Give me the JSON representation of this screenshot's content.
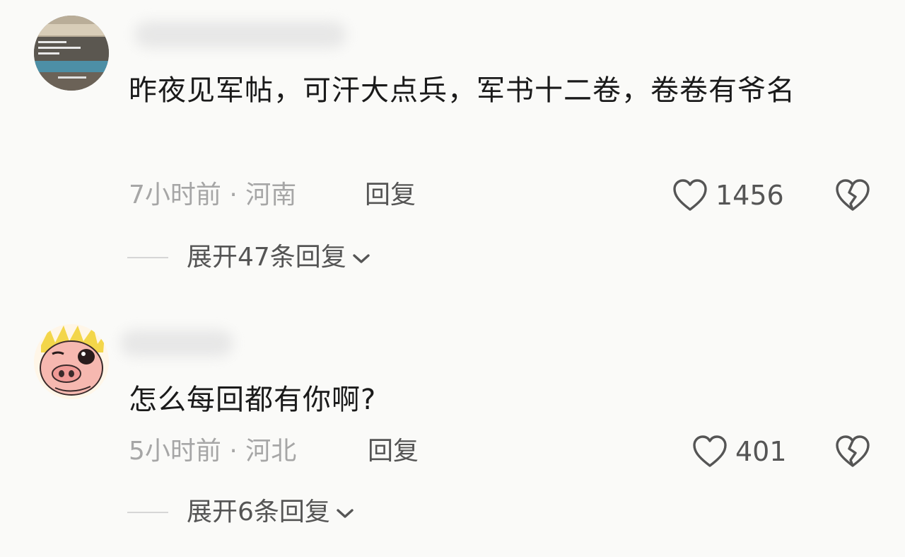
{
  "comments": [
    {
      "text": "昨夜见军帖，可汗大点兵，军书十二卷，卷卷有爷名",
      "time_location": "7小时前 · 河南",
      "reply_label": "回复",
      "likes": "1456",
      "expand_label": "展开47条回复",
      "icons": {
        "like": "heart-outline-icon",
        "dislike": "broken-heart-icon",
        "expand": "chevron-down-icon"
      }
    },
    {
      "text": "怎么每回都有你啊?",
      "time_location": "5小时前 · 河北",
      "reply_label": "回复",
      "likes": "401",
      "expand_label": "展开6条回复",
      "icons": {
        "like": "heart-outline-icon",
        "dislike": "broken-heart-icon",
        "expand": "chevron-down-icon"
      }
    }
  ],
  "colors": {
    "background": "#fafaf8",
    "text_primary": "#1a1a1a",
    "text_secondary": "#555555",
    "text_muted": "#a6a6a6"
  }
}
